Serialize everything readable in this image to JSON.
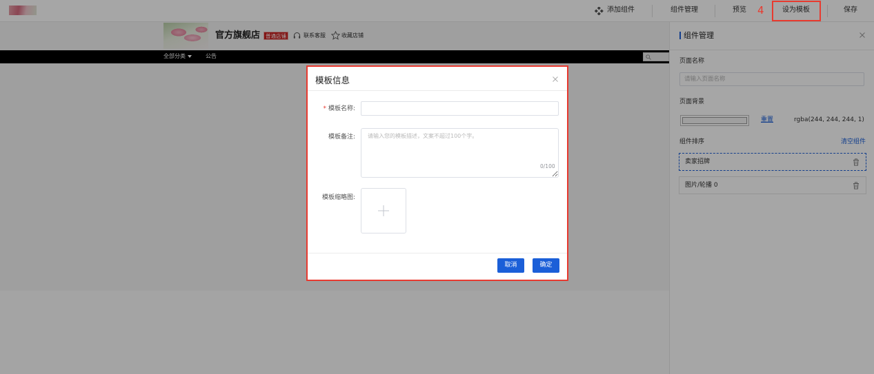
{
  "topbar": {
    "add_component": "添加组件",
    "component_manage": "组件管理",
    "preview": "预览",
    "set_template": "设为模板",
    "save": "保存",
    "step_marker": "4"
  },
  "store": {
    "name": "官方旗舰店",
    "badge": "普通店铺",
    "contact": "联系客服",
    "favorite": "收藏店铺",
    "nav": {
      "all_categories": "全部分类",
      "notice": "公告"
    }
  },
  "panel": {
    "title": "组件管理",
    "page_name_label": "页面名称",
    "page_name_placeholder": "请输入页面名称",
    "page_bg_label": "页面背景",
    "reset": "重置",
    "bg_value": "rgba(244, 244, 244, 1)",
    "sort_label": "组件排序",
    "clear": "清空组件",
    "components": [
      {
        "label": "卖家招牌"
      },
      {
        "label": "图片/轮播 0"
      }
    ]
  },
  "modal": {
    "title": "模板信息",
    "required_mark": "*",
    "name_label": "模板名称:",
    "remark_label": "模板备注:",
    "remark_placeholder": "请输入您的模板描述，文案不超过100个字。",
    "remark_count": "0/100",
    "thumb_label": "模板缩略图:",
    "cancel": "取消",
    "confirm": "确定"
  },
  "colors": {
    "accent": "#1b5fd8",
    "annotation": "#e83a2f",
    "badge": "#c8201f",
    "nav_bar": "#000000"
  },
  "icons": {
    "add_component": "grid-diamond-icon",
    "contact": "headset-icon",
    "favorite": "star-icon",
    "delete": "trash-icon",
    "upload": "plus-icon",
    "close": "close-icon"
  }
}
